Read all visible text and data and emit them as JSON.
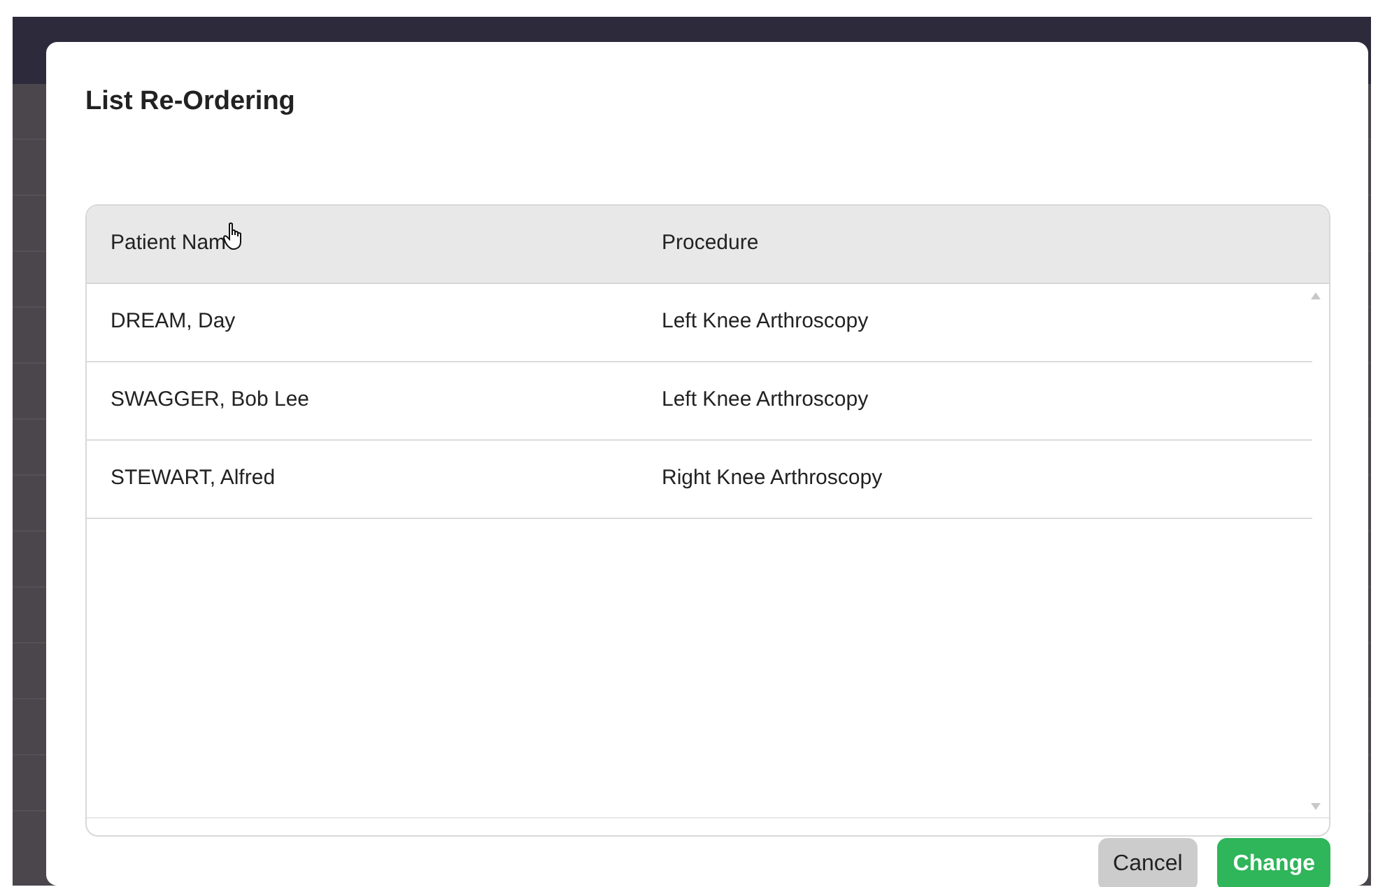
{
  "dialog": {
    "title": "List Re-Ordering",
    "table": {
      "columns": [
        "Patient Nam",
        "Procedure"
      ],
      "rows": [
        {
          "cells": [
            "DREAM, Day",
            "Left Knee Arthroscopy"
          ]
        },
        {
          "cells": [
            "SWAGGER, Bob Lee",
            "Left Knee Arthroscopy"
          ]
        },
        {
          "cells": [
            "STEWART, Alfred",
            "Right Knee Arthroscopy"
          ]
        }
      ]
    },
    "buttons": [
      {
        "label": "Cancel",
        "kind": "secondary"
      },
      {
        "label": "Change",
        "kind": "primary"
      }
    ]
  }
}
